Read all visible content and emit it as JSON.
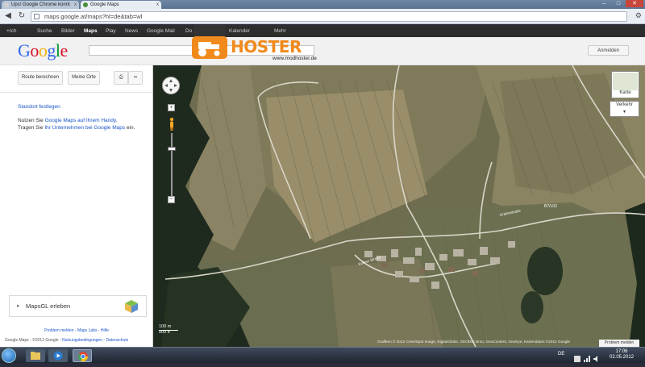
{
  "browser": {
    "tabs": [
      {
        "label": "Ups! Google Chrome konnt",
        "close": "x"
      },
      {
        "label": "Google Maps",
        "close": "x"
      }
    ],
    "url": "maps.google.at/maps?hl=de&tab=wl"
  },
  "gbar": {
    "items": [
      "+Ich",
      "Suche",
      "Bilder",
      "Maps",
      "Play",
      "News",
      "Google Mail",
      "Do",
      "Kalender",
      "Mehr"
    ],
    "active_index": 3
  },
  "header": {
    "logo": "Google",
    "signin_label": "Anmelden"
  },
  "left_panel": {
    "route_button": "Route berechnen",
    "my_places_button": "Meine Orte",
    "standort_link": "Standort festlegen",
    "help": {
      "p1_prefix": "Nutzen Sie ",
      "p1_link": "Google Maps auf Ihrem Handy",
      "p1_suffix": ".",
      "p2_prefix": "Tragen Sie ",
      "p2_link": "Ihr Unternehmen bei Google Maps",
      "p2_suffix": " ein."
    },
    "mapsgl_label": "MapsGL erleben",
    "footer_links": "Problem melden - Maps Labs - Hilfe",
    "copyright_prefix": "Google Maps - ©2012 Google - ",
    "copyright_links": "Nutzungsbedingungen - Datenschutz"
  },
  "map": {
    "karte_label": "Karte",
    "verkehr_label": "Verkehr",
    "zoom_in": "+",
    "zoom_out": "−",
    "scale_m": "100 m",
    "scale_ft": "500 ft",
    "attribution": "Grafiken © 2012 Cnes/Spot Image, DigitalGlobe, GEODIS Brno, GeoContent, GeoEye, Kartendaten ©2012 Google",
    "problem_label": "Problem melden",
    "road_labels": [
      "Grafenstraße",
      "Kulmer Straße",
      "B7/L02"
    ]
  },
  "watermark": {
    "name": "HOSTER",
    "url": "www.modhoster.de"
  },
  "taskbar": {
    "lang": "DE",
    "time": "17:06",
    "date": "02.05.2012"
  },
  "colors": {
    "google_blue": "#3369e8",
    "google_red": "#d50f25",
    "google_yellow": "#eeb211",
    "google_green": "#009925",
    "link": "#1a55c8",
    "modhoster_orange": "#f08a1c"
  }
}
